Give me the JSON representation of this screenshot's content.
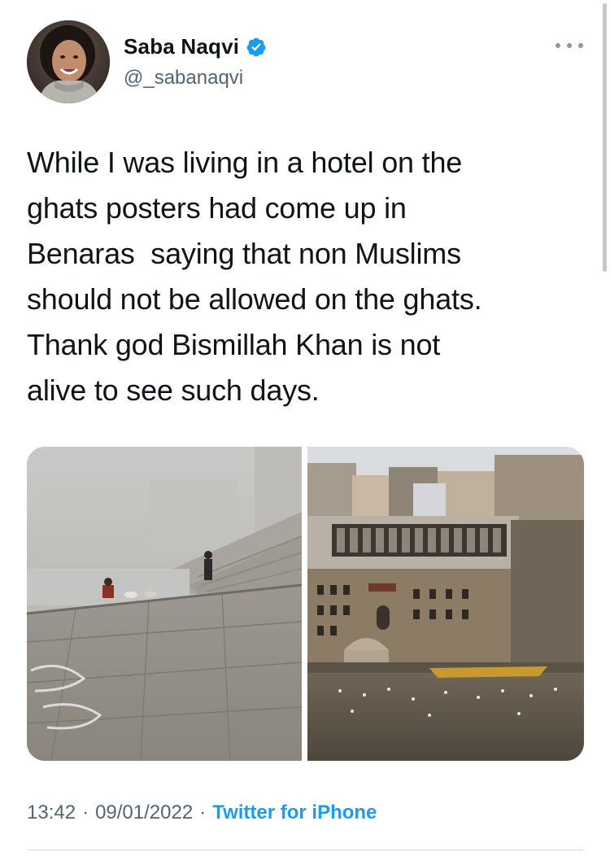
{
  "author": {
    "display_name": "Saba Naqvi",
    "handle": "@_sabanaqvi",
    "verified": true,
    "avatar_icon": "profile-photo"
  },
  "tweet": {
    "text": "While I was living in a hotel on the\nghats posters had come up in\nBenaras  saying that non Muslims\nshould not be allowed on the ghats.\nThank god Bismillah Khan is not\nalive to see such days."
  },
  "media": [
    {
      "kind": "photo",
      "subject": "foggy ghat steps with dogs"
    },
    {
      "kind": "photo",
      "subject": "riverfront buildings and boat"
    }
  ],
  "meta": {
    "time": "13:42",
    "separator": "·",
    "date": "09/01/2022",
    "source": "Twitter for iPhone"
  },
  "colors": {
    "accent": "#1d9bf0",
    "secondary_text": "#536471",
    "primary_text": "#0f1419"
  },
  "icons": {
    "more": "more-horizontal-icon",
    "verified": "verified-badge-icon"
  }
}
